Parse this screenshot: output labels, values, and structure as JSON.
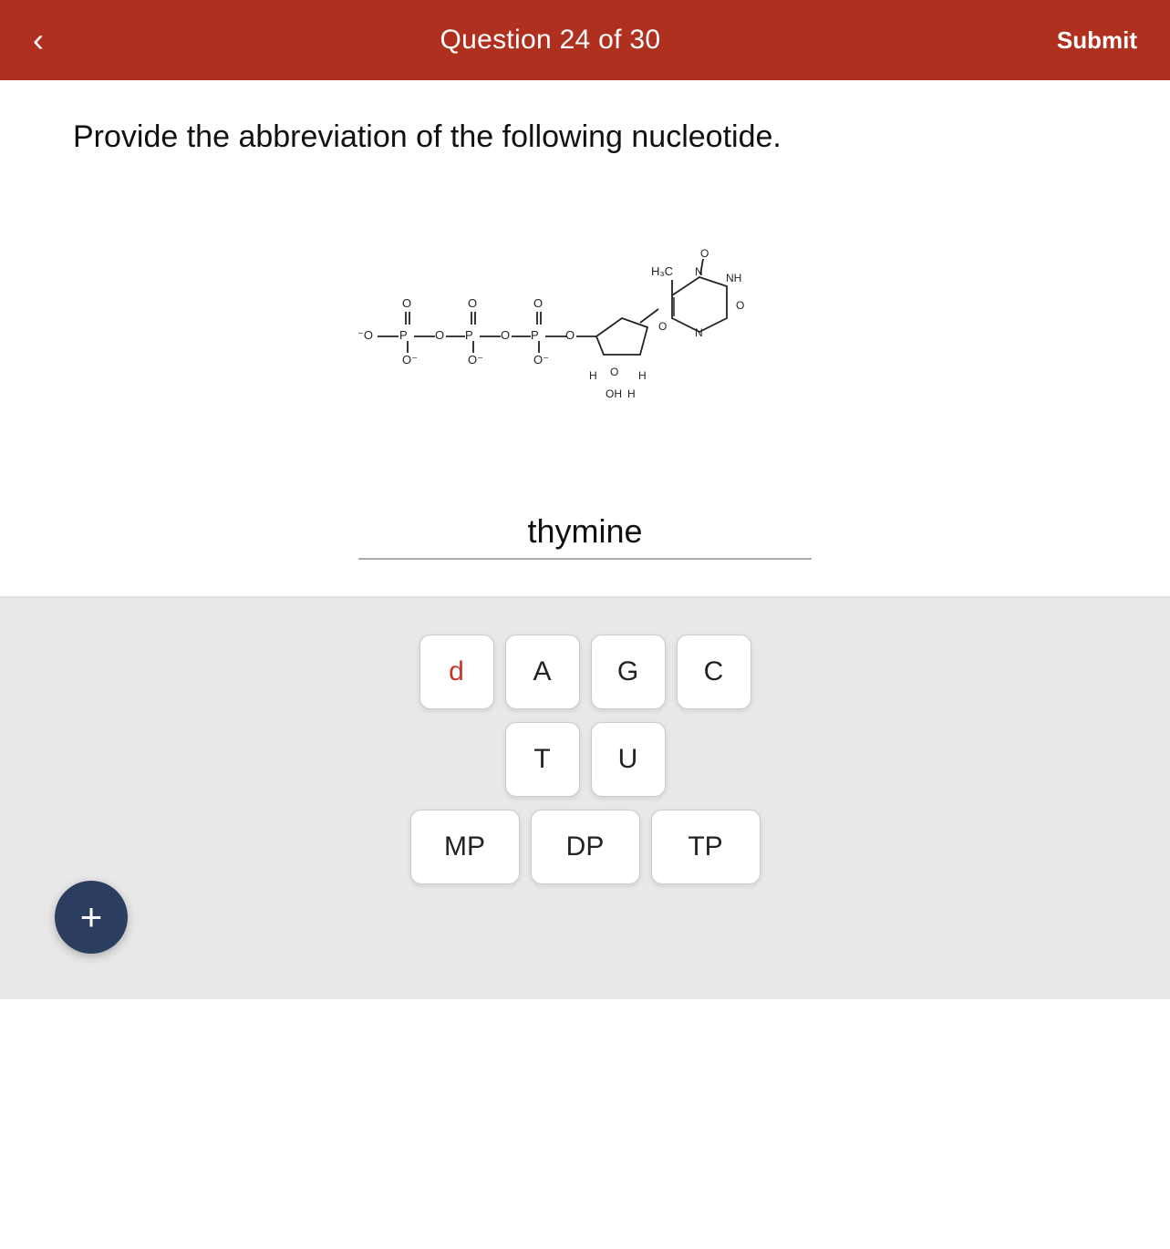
{
  "header": {
    "title": "Question 24 of 30",
    "submit_label": "Submit",
    "back_icon": "‹"
  },
  "question": {
    "text": "Provide the abbreviation of the following nucleotide."
  },
  "input": {
    "value": "thymine",
    "placeholder": ""
  },
  "keyboard": {
    "row1": [
      "d",
      "A",
      "G",
      "C"
    ],
    "row2": [
      "T",
      "U"
    ],
    "row3": [
      "MP",
      "DP",
      "TP"
    ]
  },
  "plus_button_label": "+",
  "colors": {
    "header_bg": "#b03020",
    "red_text": "#c0392b",
    "plus_bg": "#2c3e60"
  }
}
